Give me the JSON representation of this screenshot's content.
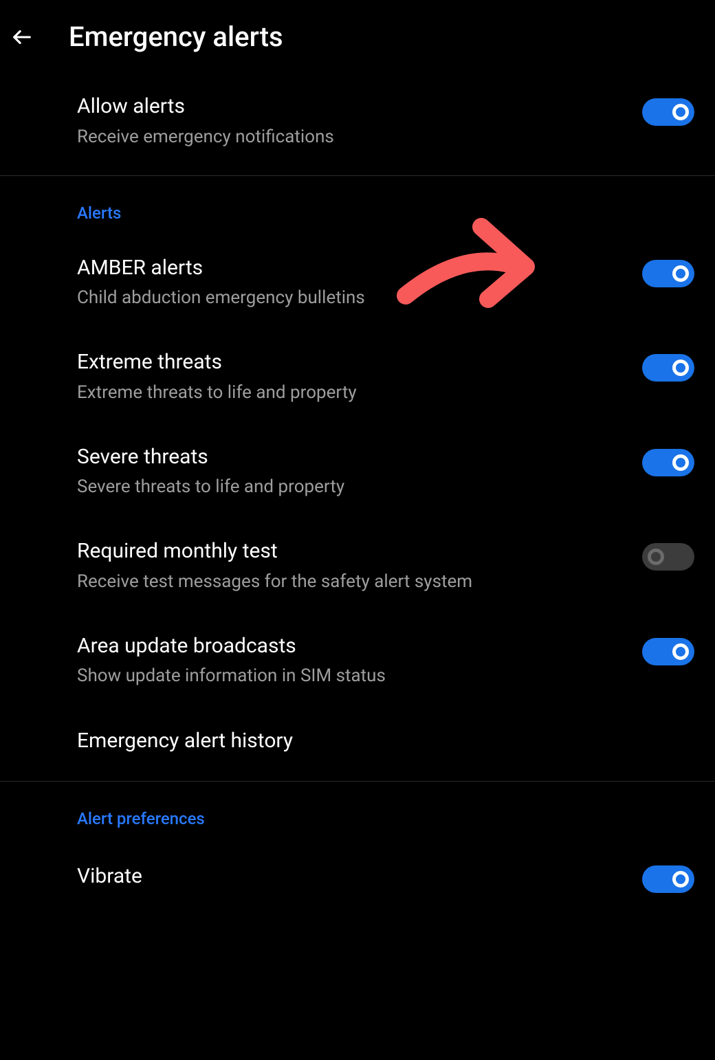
{
  "header": {
    "title": "Emergency alerts"
  },
  "allow_alerts": {
    "title": "Allow alerts",
    "subtitle": "Receive emergency notifications",
    "enabled": true
  },
  "sections": {
    "alerts": {
      "header": "Alerts",
      "items": [
        {
          "key": "amber",
          "title": "AMBER alerts",
          "subtitle": "Child abduction emergency bulletins",
          "enabled": true,
          "has_toggle": true
        },
        {
          "key": "extreme",
          "title": "Extreme threats",
          "subtitle": "Extreme threats to life and property",
          "enabled": true,
          "has_toggle": true
        },
        {
          "key": "severe",
          "title": "Severe threats",
          "subtitle": "Severe threats to life and property",
          "enabled": true,
          "has_toggle": true
        },
        {
          "key": "monthly_test",
          "title": "Required monthly test",
          "subtitle": "Receive test messages for the safety alert system",
          "enabled": false,
          "has_toggle": true
        },
        {
          "key": "area_update",
          "title": "Area update broadcasts",
          "subtitle": "Show update information in SIM status",
          "enabled": true,
          "has_toggle": true
        },
        {
          "key": "history",
          "title": "Emergency alert history",
          "subtitle": "",
          "enabled": null,
          "has_toggle": false
        }
      ]
    },
    "preferences": {
      "header": "Alert preferences",
      "items": [
        {
          "key": "vibrate",
          "title": "Vibrate",
          "subtitle": "",
          "enabled": true,
          "has_toggle": true
        }
      ]
    }
  },
  "colors": {
    "accent": "#1a73e8",
    "section_header": "#2979ff",
    "annotation": "#f85a5a"
  }
}
